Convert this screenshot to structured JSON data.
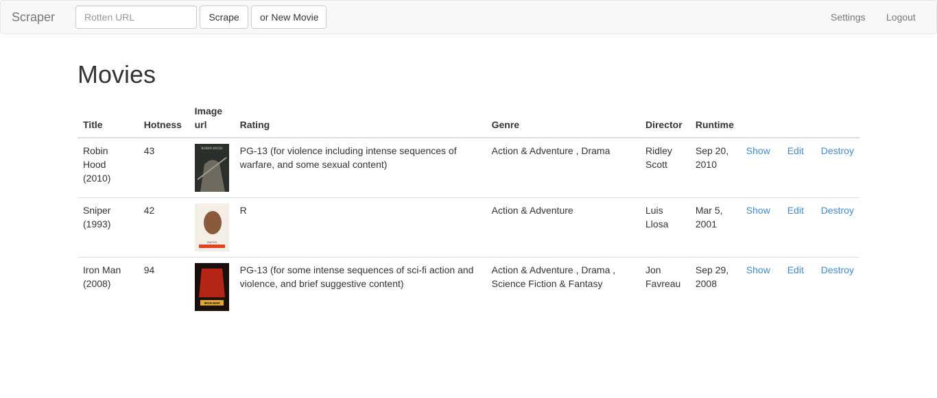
{
  "navbar": {
    "brand": "Scraper",
    "url_placeholder": "Rotten URL",
    "scrape_label": "Scrape",
    "new_movie_label": "or New Movie",
    "settings_label": "Settings",
    "logout_label": "Logout"
  },
  "page": {
    "title": "Movies"
  },
  "table": {
    "headers": {
      "title": "Title",
      "hotness": "Hotness",
      "image_url": "Image url",
      "rating": "Rating",
      "genre": "Genre",
      "director": "Director",
      "runtime": "Runtime"
    },
    "actions": {
      "show": "Show",
      "edit": "Edit",
      "destroy": "Destroy"
    },
    "rows": [
      {
        "title": "Robin Hood (2010)",
        "hotness": "43",
        "poster_colors": [
          "#2b2f2c",
          "#6e6a5e",
          "#a09b8a"
        ],
        "poster_caption": "ROBIN HOOD",
        "rating": "PG-13 (for violence including intense sequences of warfare, and some sexual content)",
        "genre": "Action & Adventure , Drama",
        "director": "Ridley Scott",
        "runtime": "Sep 20, 2010"
      },
      {
        "title": "Sniper (1993)",
        "hotness": "42",
        "poster_colors": [
          "#f3efe6",
          "#8a5a3c",
          "#e8401c"
        ],
        "poster_caption": "SNIPER",
        "rating": "R",
        "genre": "Action & Adventure",
        "director": "Luis Llosa",
        "runtime": "Mar 5, 2001"
      },
      {
        "title": "Iron Man (2008)",
        "hotness": "94",
        "poster_colors": [
          "#1a0f0a",
          "#b52516",
          "#e0a73a"
        ],
        "poster_caption": "IRON MAN",
        "rating": "PG-13 (for some intense sequences of sci-fi action and violence, and brief suggestive content)",
        "genre": "Action & Adventure , Drama , Science Fiction & Fantasy",
        "director": "Jon Favreau",
        "runtime": "Sep 29, 2008"
      }
    ]
  },
  "colors": {
    "link": "#428bca",
    "navbar_bg": "#f8f8f8",
    "navbar_text": "#777777",
    "border": "#dddddd"
  }
}
